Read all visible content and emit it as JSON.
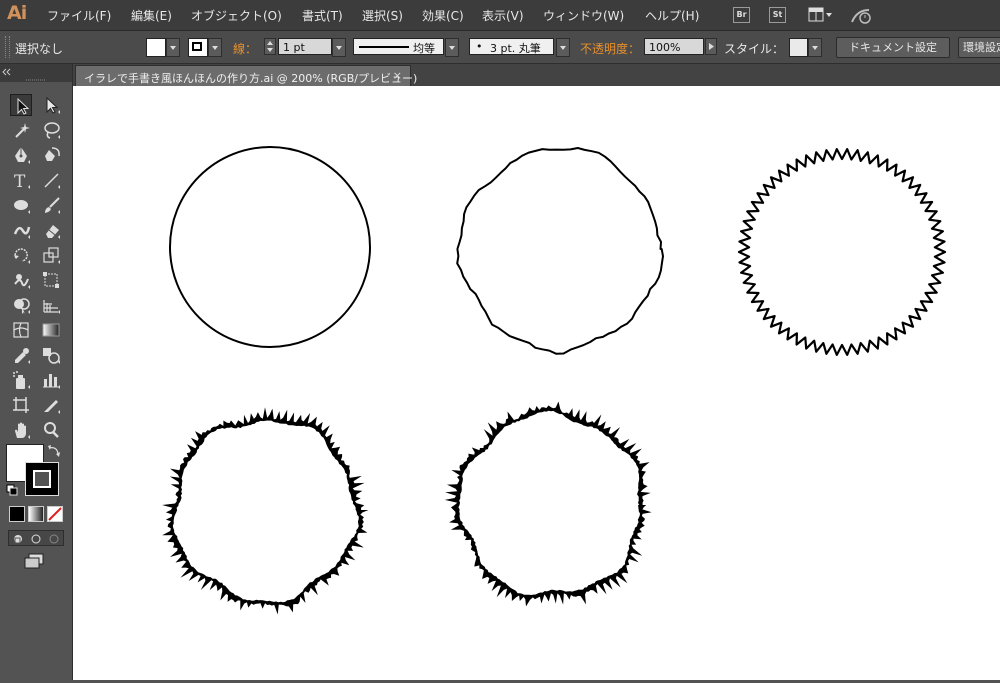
{
  "app": {
    "logo": "Ai"
  },
  "menubar": {
    "items": [
      "ファイル(F)",
      "編集(E)",
      "オブジェクト(O)",
      "書式(T)",
      "選択(S)",
      "効果(C)",
      "表示(V)",
      "ウィンドウ(W)",
      "ヘルプ(H)"
    ],
    "bridge_label": "Br",
    "stock_label": "St"
  },
  "controlbar": {
    "selection_status": "選択なし",
    "stroke_label": "線：",
    "stroke_weight": "1 pt",
    "stroke_profile": "均等",
    "brush_dot": "•",
    "brush": "3 pt. 丸筆",
    "opacity_label": "不透明度：",
    "opacity_value": "100%",
    "style_label": "スタイル：",
    "document_setup": "ドキュメント設定",
    "preferences": "環境設定"
  },
  "document": {
    "tab_title": "イラレで手書き風ほんほんの作り方.ai @ 200% (RGB/プレビュー)",
    "close_glyph": "×"
  },
  "artwork": {
    "shapes": [
      "plain-circle",
      "roughened-circle",
      "zigzag-circle",
      "fringed-circle-1",
      "fringed-circle-2"
    ],
    "stroke_color": "#000000"
  },
  "colors": {
    "fill": "#ffffff",
    "stroke": "#000000",
    "accent_label": "#e8902c"
  },
  "tools": [
    "selection-tool",
    "direct-selection-tool",
    "magic-wand-tool",
    "lasso-tool",
    "pen-tool",
    "curvature-pen-tool",
    "type-tool",
    "line-tool",
    "ellipse-tool",
    "paintbrush-tool",
    "shaper-tool",
    "eraser-tool",
    "rotate-tool",
    "scale-tool",
    "warp-tool",
    "free-transform-tool",
    "shape-builder-tool",
    "perspective-grid-tool",
    "mesh-tool",
    "gradient-tool",
    "eyedropper-tool",
    "blend-tool",
    "symbol-sprayer-tool",
    "column-graph-tool",
    "artboard-tool",
    "slice-tool",
    "hand-tool",
    "zoom-tool"
  ]
}
